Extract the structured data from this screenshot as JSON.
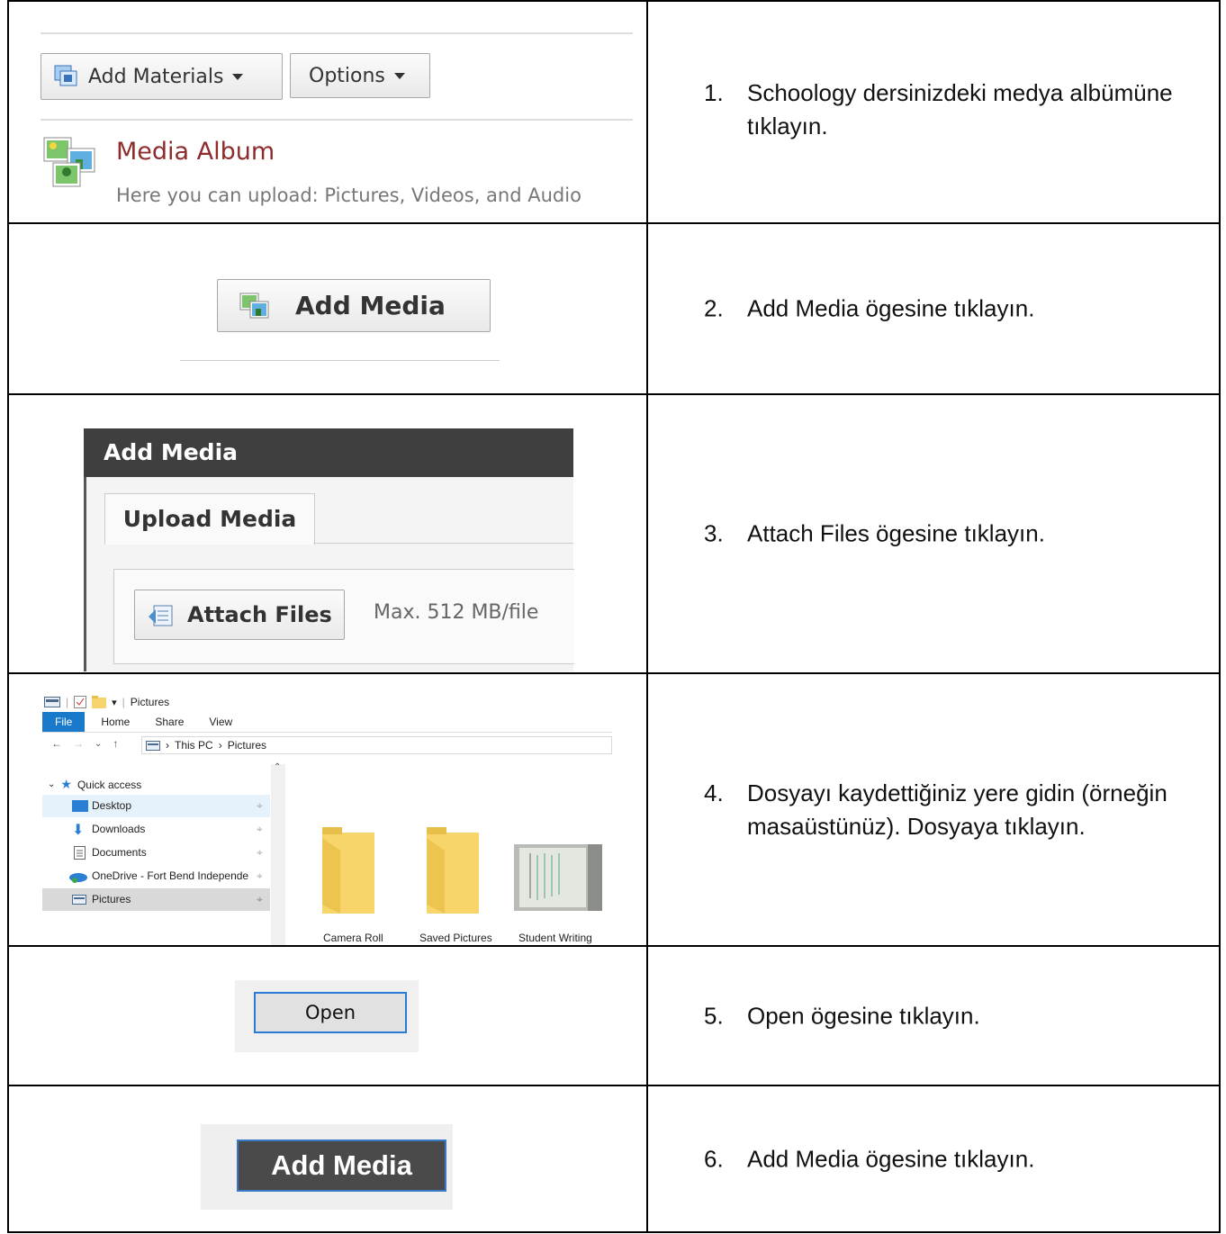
{
  "steps": [
    {
      "number": "1.",
      "text": "Schoology dersinizdeki medya albümüne tıklayın."
    },
    {
      "number": "2.",
      "text": "Add Media ögesine tıklayın."
    },
    {
      "number": "3.",
      "text": "Attach Files ögesine tıklayın."
    },
    {
      "number": "4.",
      "text": "Dosyayı kaydettiğiniz yere gidin (örneğin masaüstünüz). Dosyaya tıklayın."
    },
    {
      "number": "5.",
      "text": "Open ögesine tıklayın."
    },
    {
      "number": "6.",
      "text": "Add Media ögesine tıklayın."
    }
  ],
  "shot1": {
    "add_materials": "Add Materials",
    "options": "Options",
    "album_title": "Media Album",
    "album_desc": "Here you can upload: Pictures, Videos, and Audio"
  },
  "shot2": {
    "button": "Add Media"
  },
  "shot3": {
    "dialog_title": "Add Media",
    "tab": "Upload Media",
    "attach": "Attach Files",
    "limit": "Max. 512 MB/file"
  },
  "shot4": {
    "window_title": "Pictures",
    "ribbon": [
      "File",
      "Home",
      "Share",
      "View"
    ],
    "path": [
      "This PC",
      "Pictures"
    ],
    "quick_access": "Quick access",
    "nav": [
      "Desktop",
      "Downloads",
      "Documents",
      "OneDrive - Fort Bend Independe",
      "Pictures"
    ],
    "folders": [
      "Camera Roll",
      "Saved Pictures",
      "Student Writing"
    ]
  },
  "shot5": {
    "button": "Open"
  },
  "shot6": {
    "button": "Add Media"
  },
  "colors": {
    "border": "#000000",
    "album_title": "#8e2c2c",
    "ribbon_file": "#1979ca",
    "focus": "#2b7bd6"
  }
}
